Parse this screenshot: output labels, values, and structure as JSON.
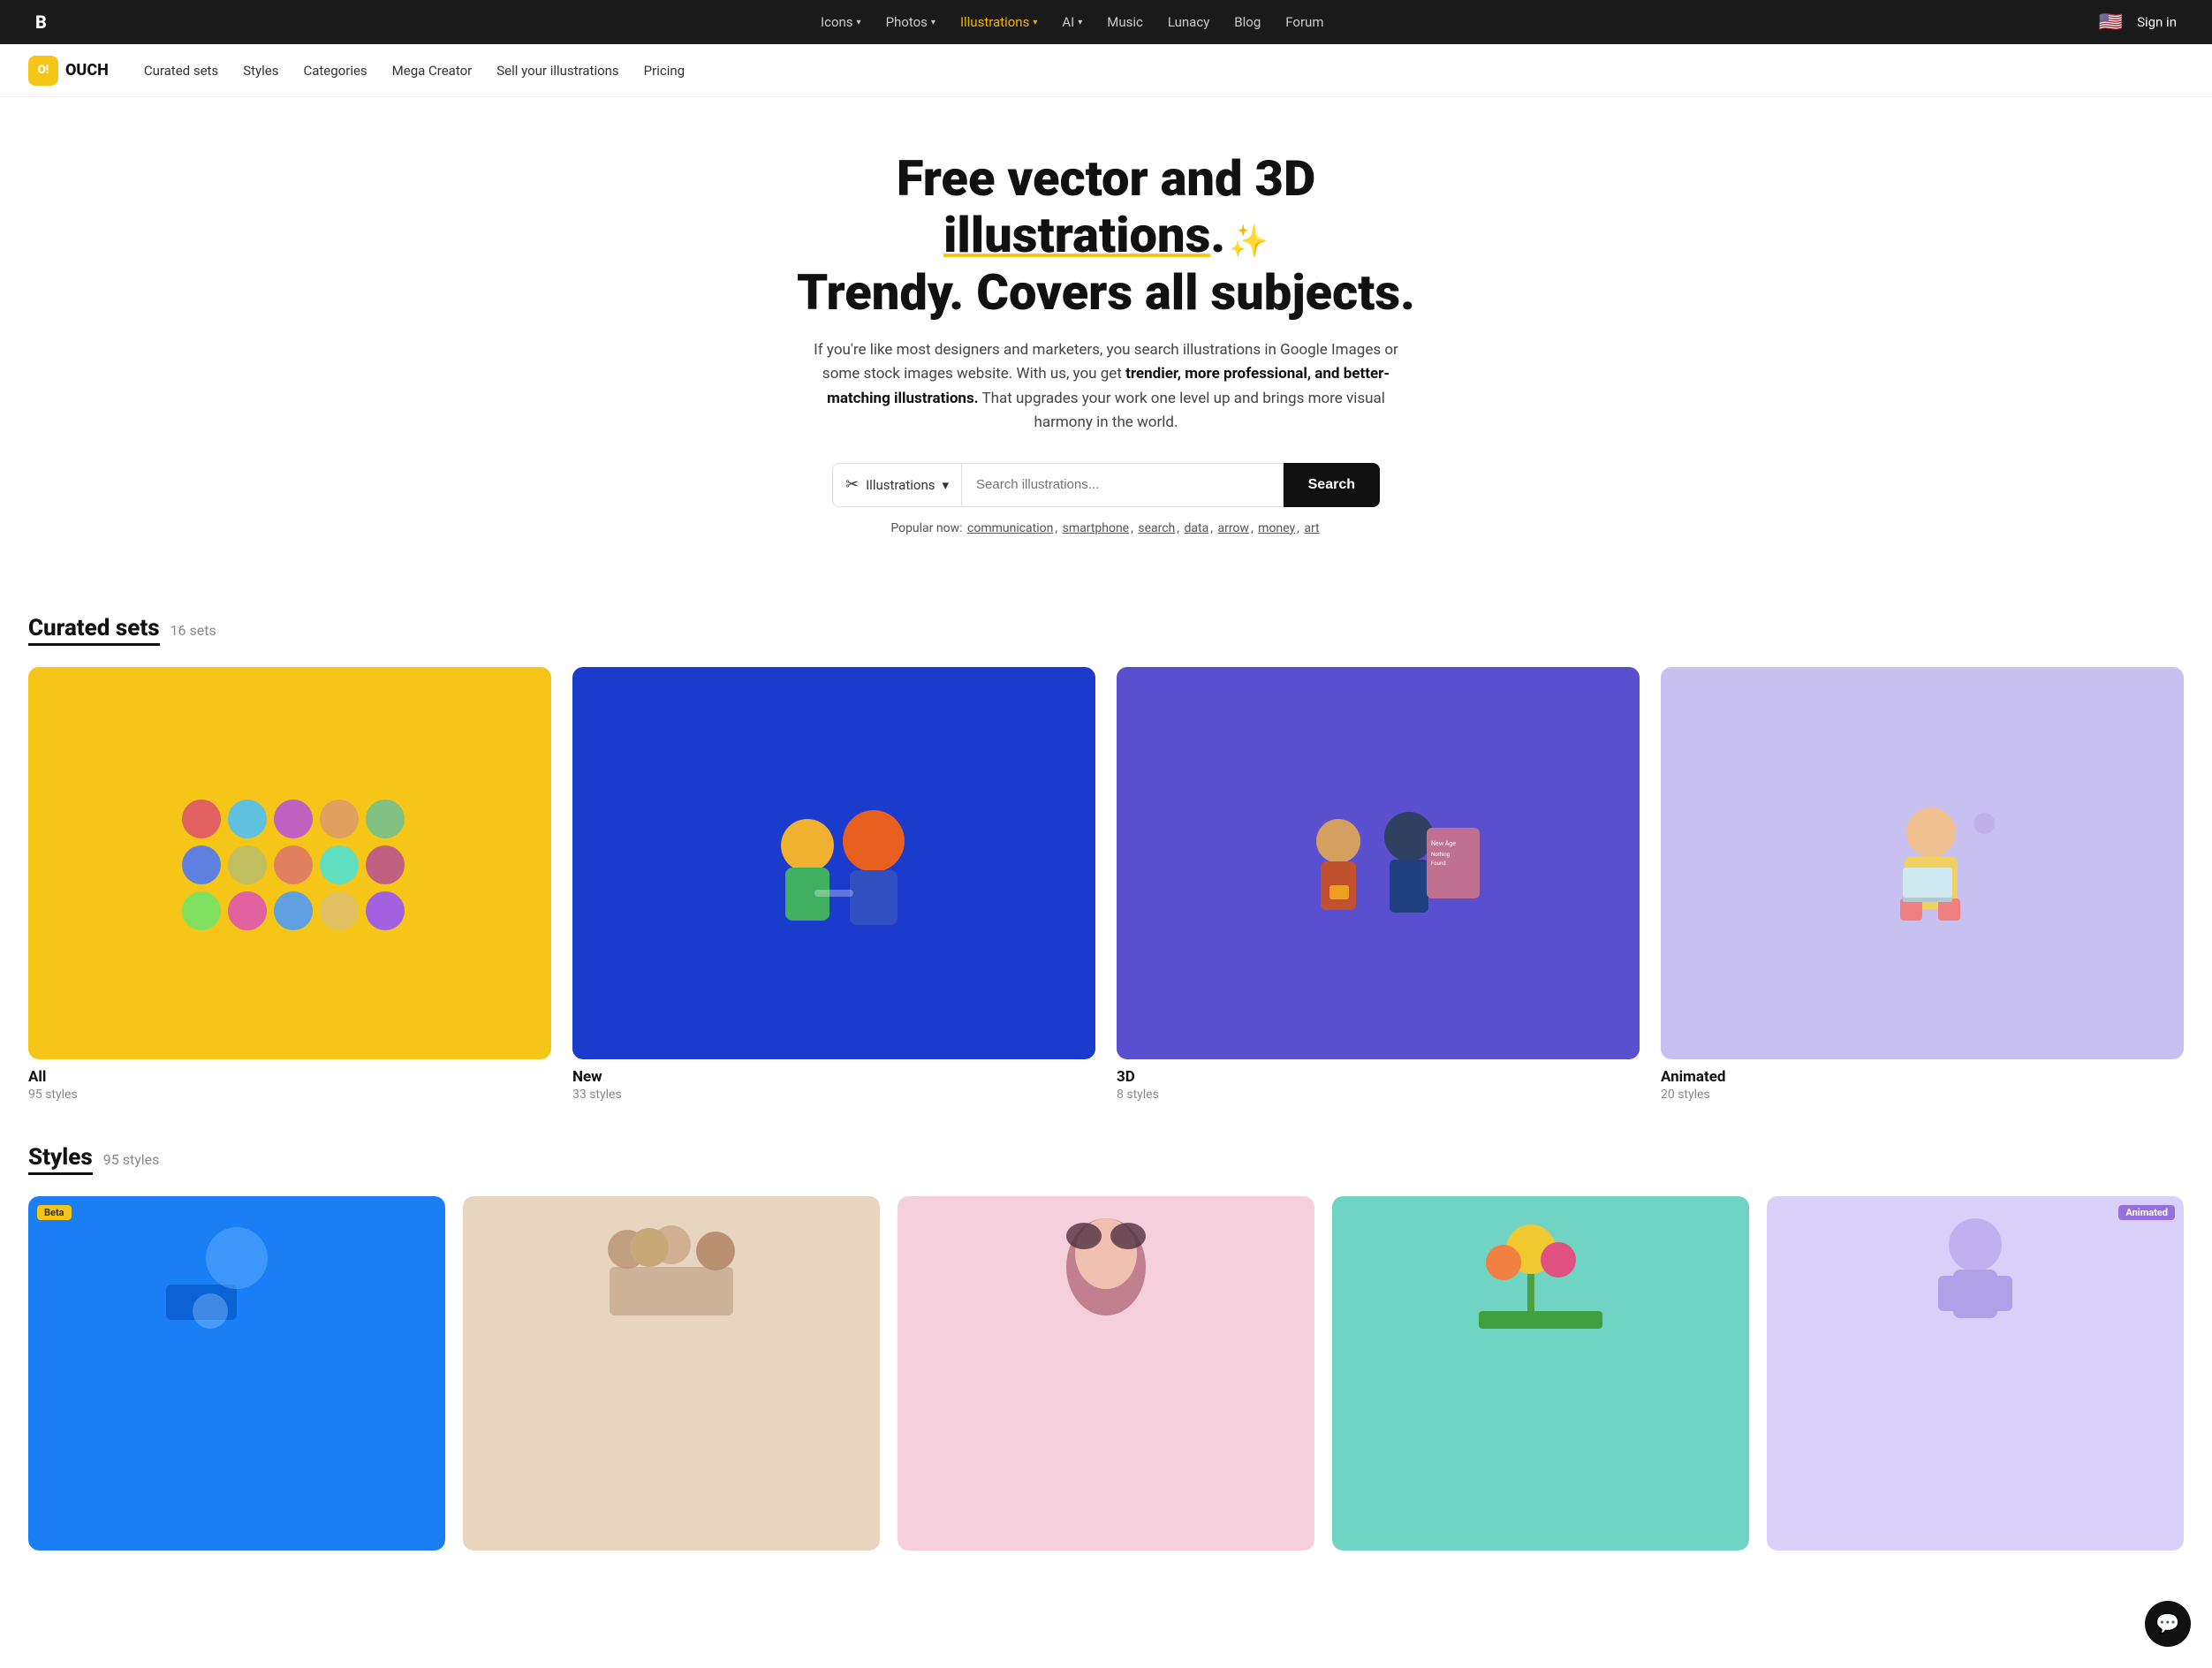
{
  "topnav": {
    "logo": "B",
    "links": [
      {
        "label": "Icons",
        "hasDropdown": true,
        "active": false
      },
      {
        "label": "Photos",
        "hasDropdown": true,
        "active": false
      },
      {
        "label": "Illustrations",
        "hasDropdown": true,
        "active": true
      },
      {
        "label": "AI",
        "hasDropdown": true,
        "active": false
      },
      {
        "label": "Music",
        "hasDropdown": false,
        "active": false
      },
      {
        "label": "Lunacy",
        "hasDropdown": false,
        "active": false
      },
      {
        "label": "Blog",
        "hasDropdown": false,
        "active": false
      },
      {
        "label": "Forum",
        "hasDropdown": false,
        "active": false
      }
    ],
    "flag": "🇺🇸",
    "signin": "Sign in"
  },
  "subnav": {
    "brand": "OUCH",
    "links": [
      {
        "label": "Curated sets"
      },
      {
        "label": "Styles"
      },
      {
        "label": "Categories"
      },
      {
        "label": "Mega Creator"
      },
      {
        "label": "Sell your illustrations"
      },
      {
        "label": "Pricing"
      }
    ]
  },
  "hero": {
    "headline_part1": "Free vector and 3D ",
    "headline_underline": "illustrations",
    "headline_part2": ".",
    "headline_line2": "Trendy. Covers all subjects.",
    "description_normal": "If you're like most designers and marketers, you search illustrations in Google Images or some stock images website. With us, you get ",
    "description_bold": "trendier, more professional, and better-matching illustrations.",
    "description_end": " That upgrades your work one level up and brings more visual harmony in the world."
  },
  "search": {
    "type_label": "Illustrations",
    "placeholder": "Search illustrations...",
    "button_label": "Search"
  },
  "popular": {
    "prefix": "Popular now:",
    "tags": [
      "communication",
      "smartphone",
      "search",
      "data",
      "arrow",
      "money",
      "art"
    ]
  },
  "curated": {
    "section_title": "Curated sets",
    "section_count": "16 sets",
    "cards": [
      {
        "title": "All",
        "subtitle": "95 styles",
        "bg": "yellow-bg"
      },
      {
        "title": "New",
        "subtitle": "33 styles",
        "bg": "blue-bg"
      },
      {
        "title": "3D",
        "subtitle": "8 styles",
        "bg": "purple-bg"
      },
      {
        "title": "Animated",
        "subtitle": "20 styles",
        "bg": "lavender-bg"
      }
    ]
  },
  "styles": {
    "section_title": "Styles",
    "section_count": "95 styles",
    "cards": [
      {
        "bg": "blue",
        "badge": "Beta",
        "badge_type": "beta"
      },
      {
        "bg": "beige",
        "badge": null
      },
      {
        "bg": "pink",
        "badge": null
      },
      {
        "bg": "teal",
        "badge": null
      },
      {
        "bg": "light-lavender",
        "badge": "Animated",
        "badge_type": "animated"
      }
    ]
  },
  "chat": {
    "icon": "💬"
  }
}
